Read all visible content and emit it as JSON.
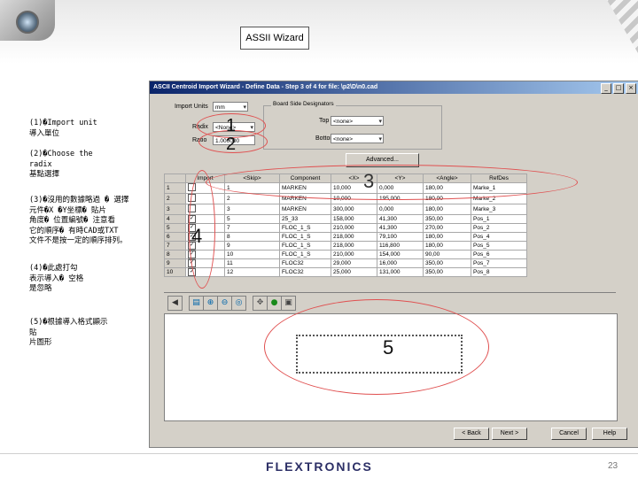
{
  "slide": {
    "title": "ASSII Wizard",
    "footer_logo": "FLEXTRONICS",
    "page_number": "23"
  },
  "notes": [
    "(1)�Import unit\n導入單位",
    "(2)�Choose the\nradix\n基點選擇",
    "(3)�沒用的數據略過 � 選擇\n元件�X �Y坐標� 貼片\n角度� 位置編號� 注意看\n它的順序� 有時CAD或TXT\n文件不是按一定的順序排列。",
    "(4)�此處打勾\n表示導入� 空格\n是忽略",
    "(5)�根據導入格式顯示\n貼\n片圖形"
  ],
  "annotations": [
    "1",
    "2",
    "3",
    "4",
    "5"
  ],
  "wizard": {
    "title": "ASCII Centroid Import Wizard - Define Data - Step 3 of 4 for file: \\p2\\D\\n0.cad",
    "import_units_label": "Import Units",
    "import_units_value": "mm",
    "radix_label": "Radix",
    "radix_value": "<None>",
    "ratio_label": "Ratio",
    "ratio_value": "1.000000",
    "board_side_group": "Board Side Designators",
    "top_label": "Top",
    "top_value": "<none>",
    "bottom_label": "Bottom",
    "bottom_value": "<none>",
    "advanced_button": "Advanced...",
    "columns": [
      "Import",
      "<Skip>",
      "Component",
      "<X>",
      "<Y>",
      "<Angle>",
      "RefDes"
    ],
    "rows": [
      {
        "n": "1",
        "chk": "",
        "skip": "1",
        "comp": "MARKEN",
        "x": "10,000",
        "y": "0,000",
        "a": "180,00",
        "ref": "Marke_1"
      },
      {
        "n": "2",
        "chk": "",
        "skip": "2",
        "comp": "MARKEN",
        "x": "10,000",
        "y": "195,000",
        "a": "180,00",
        "ref": "Marke_2"
      },
      {
        "n": "3",
        "chk": "",
        "skip": "3",
        "comp": "MARKEN",
        "x": "300,000",
        "y": "0,000",
        "a": "180,00",
        "ref": "Marke_3"
      },
      {
        "n": "4",
        "chk": "✓",
        "skip": "5",
        "comp": "25_33",
        "x": "158,000",
        "y": "41,300",
        "a": "350,00",
        "ref": "Pos_1"
      },
      {
        "n": "5",
        "chk": "✓",
        "skip": "7",
        "comp": "FLOC_1_S",
        "x": "210,000",
        "y": "41,300",
        "a": "270,00",
        "ref": "Pos_2"
      },
      {
        "n": "6",
        "chk": "✓",
        "skip": "8",
        "comp": "FLOC_1_S",
        "x": "218,000",
        "y": "79,100",
        "a": "180,00",
        "ref": "Pos_4"
      },
      {
        "n": "7",
        "chk": "✓",
        "skip": "9",
        "comp": "FLOC_1_S",
        "x": "218,000",
        "y": "116,800",
        "a": "180,00",
        "ref": "Pos_5"
      },
      {
        "n": "8",
        "chk": "✓",
        "skip": "10",
        "comp": "FLOC_1_S",
        "x": "210,000",
        "y": "154,000",
        "a": "90,00",
        "ref": "Pos_6"
      },
      {
        "n": "9",
        "chk": "✓",
        "skip": "11",
        "comp": "FLOC32",
        "x": "29,000",
        "y": "16,000",
        "a": "350,00",
        "ref": "Pos_7"
      },
      {
        "n": "10",
        "chk": "✓",
        "skip": "12",
        "comp": "FLOC32",
        "x": "25,000",
        "y": "131,000",
        "a": "350,00",
        "ref": "Pos_8"
      }
    ],
    "back_button": "< Back",
    "next_button": "Next >",
    "cancel_button": "Cancel",
    "help_button": "Help"
  }
}
